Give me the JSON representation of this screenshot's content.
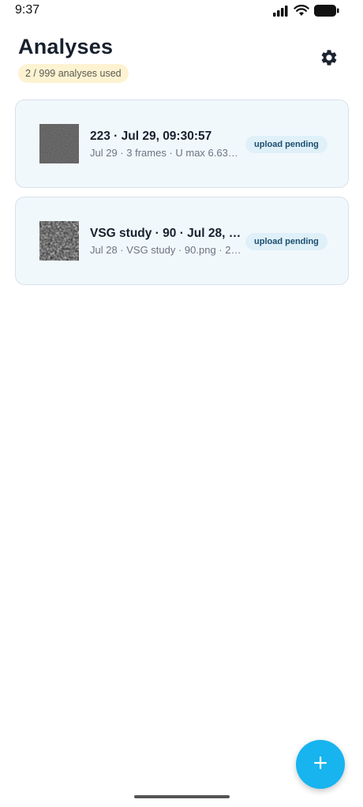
{
  "status_bar": {
    "time": "9:37",
    "icons": [
      "signal-icon",
      "wifi-icon",
      "battery-icon"
    ]
  },
  "header": {
    "title": "Analyses",
    "usage": "2 / 999 analyses used",
    "settings_icon": "gear-icon"
  },
  "analyses": [
    {
      "title": "223 · Jul 29, 09:30:57",
      "subtitle": "Jul 29 · 3 frames · U max 6.63…",
      "status": "upload pending"
    },
    {
      "title": "VSG study · 90 · Jul 28, 1…",
      "subtitle": "Jul 28 · VSG study · 90.png · 2…",
      "status": "upload pending"
    }
  ],
  "fab": {
    "icon": "plus-icon"
  },
  "colors": {
    "accent": "#17b4ef",
    "card_background": "#f1f8fc",
    "usage_badge_background": "#fdf3d2",
    "status_badge_background": "#dff0f9"
  }
}
